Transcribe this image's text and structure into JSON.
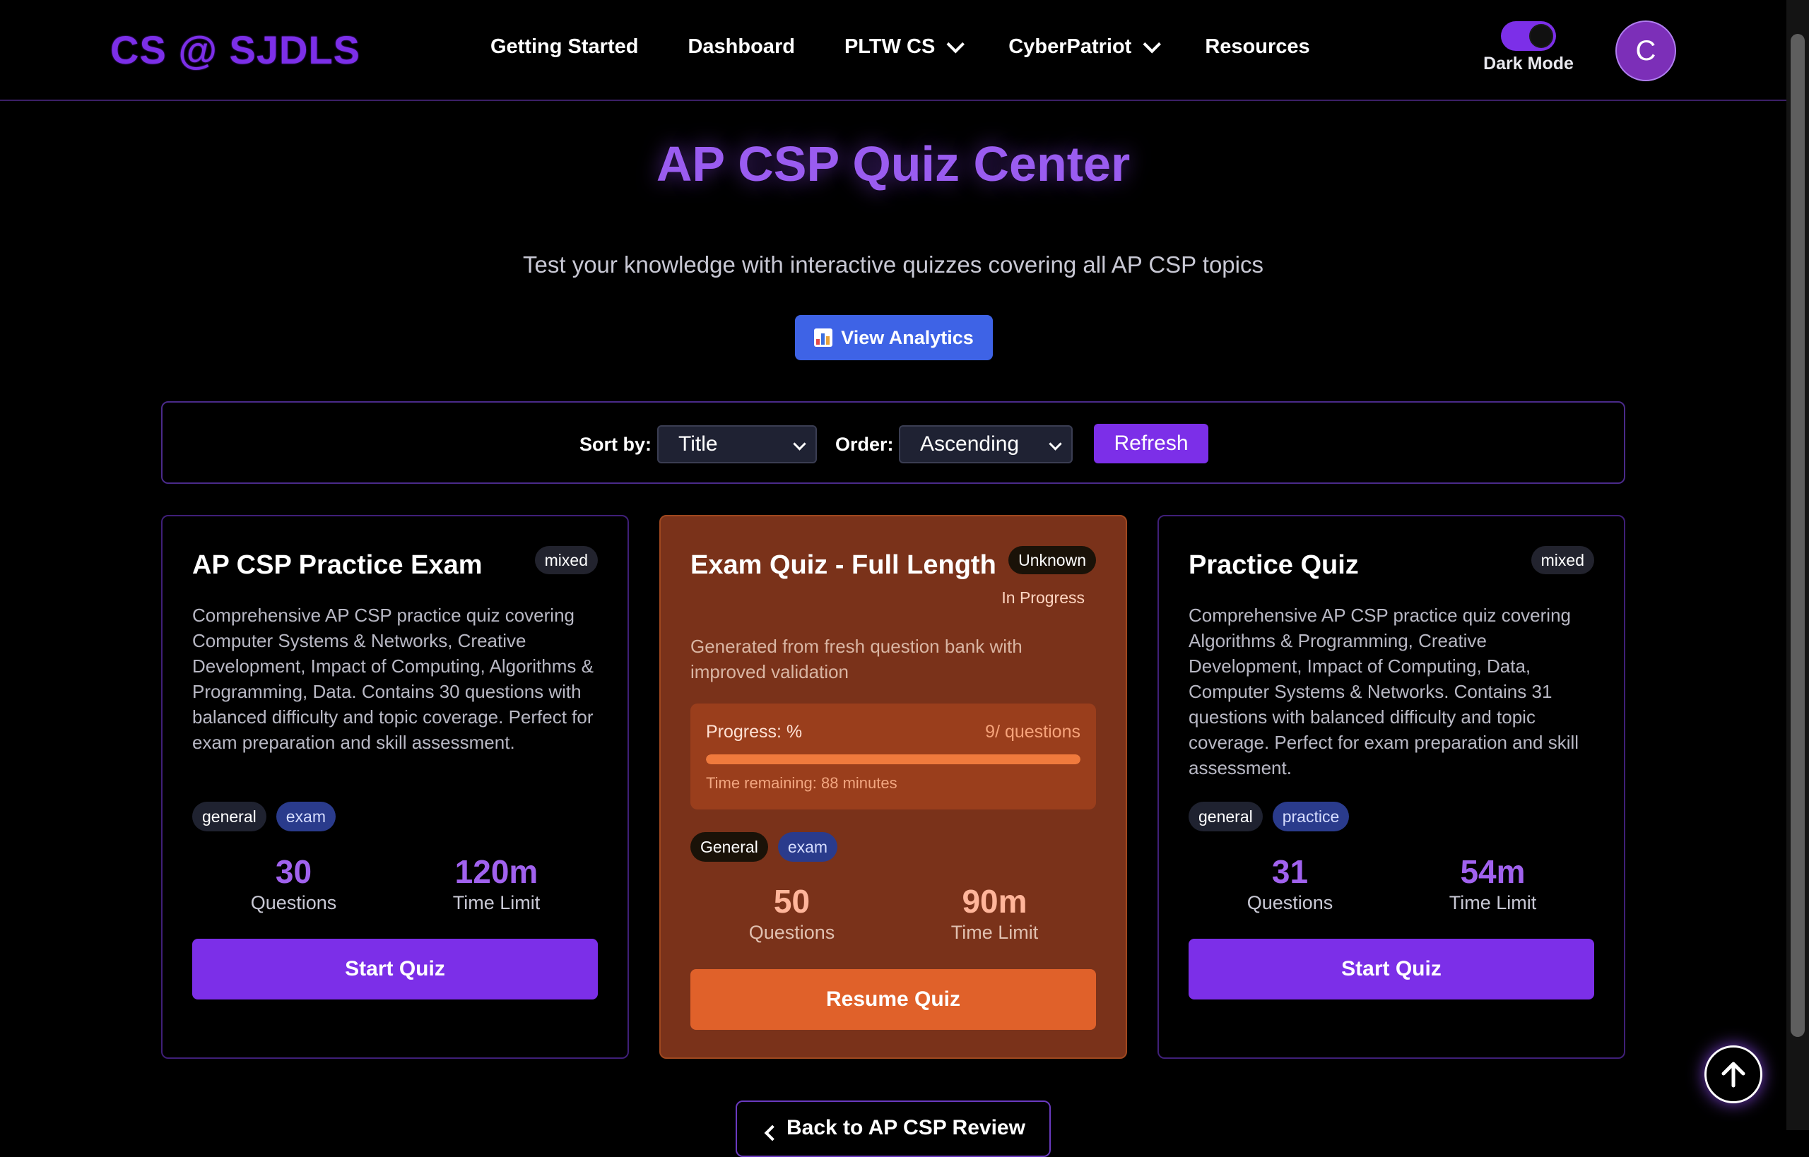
{
  "nav": {
    "brand": "CS @ SJDLS",
    "links": [
      {
        "label": "Getting Started",
        "dropdown": false
      },
      {
        "label": "Dashboard",
        "dropdown": false
      },
      {
        "label": "PLTW CS",
        "dropdown": true
      },
      {
        "label": "CyberPatriot",
        "dropdown": true
      },
      {
        "label": "Resources",
        "dropdown": false
      }
    ],
    "dark_mode_label": "Dark Mode",
    "dark_mode_on": true,
    "avatar_initial": "C"
  },
  "header": {
    "title": "AP CSP Quiz Center",
    "subtitle": "Test your knowledge with interactive quizzes covering all AP CSP topics",
    "analytics_button": "View Analytics"
  },
  "sort": {
    "sort_label": "Sort by:",
    "sort_value": "Title",
    "order_label": "Order:",
    "order_value": "Ascending",
    "refresh_label": "Refresh"
  },
  "quizzes": [
    {
      "title": "AP CSP Practice Exam",
      "badge": "mixed",
      "description": "Comprehensive AP CSP practice quiz covering Computer Systems & Networks, Creative Development, Impact of Computing, Algorithms & Programming, Data. Contains 30 questions with balanced difficulty and topic coverage. Perfect for exam preparation and skill assessment.",
      "tags": [
        "general",
        "exam"
      ],
      "questions": "30",
      "questions_label": "Questions",
      "time_limit": "120m",
      "time_label": "Time Limit",
      "button": "Start Quiz"
    },
    {
      "title": "Exam Quiz - Full Length",
      "badge": "Unknown",
      "status": "In Progress",
      "description": "Generated from fresh question bank with improved validation",
      "progress_label": "Progress: %",
      "progress_count": "9/ questions",
      "progress_fraction": 1.0,
      "time_remaining": "Time remaining: 88 minutes",
      "tags": [
        "General",
        "exam"
      ],
      "questions": "50",
      "questions_label": "Questions",
      "time_limit": "90m",
      "time_label": "Time Limit",
      "button": "Resume Quiz"
    },
    {
      "title": "Practice Quiz",
      "badge": "mixed",
      "description": "Comprehensive AP CSP practice quiz covering Algorithms & Programming, Creative Development, Impact of Computing, Data, Computer Systems & Networks. Contains 31 questions with balanced difficulty and topic coverage. Perfect for exam preparation and skill assessment.",
      "tags": [
        "general",
        "practice"
      ],
      "questions": "31",
      "questions_label": "Questions",
      "time_limit": "54m",
      "time_label": "Time Limit",
      "button": "Start Quiz"
    }
  ],
  "footer": {
    "back_link": "Back to AP CSP Review"
  },
  "colors": {
    "accent": "#7c2fe8",
    "active_card": "#7a321a",
    "resume_button": "#e0612a",
    "analytics_button": "#3e63e6"
  }
}
